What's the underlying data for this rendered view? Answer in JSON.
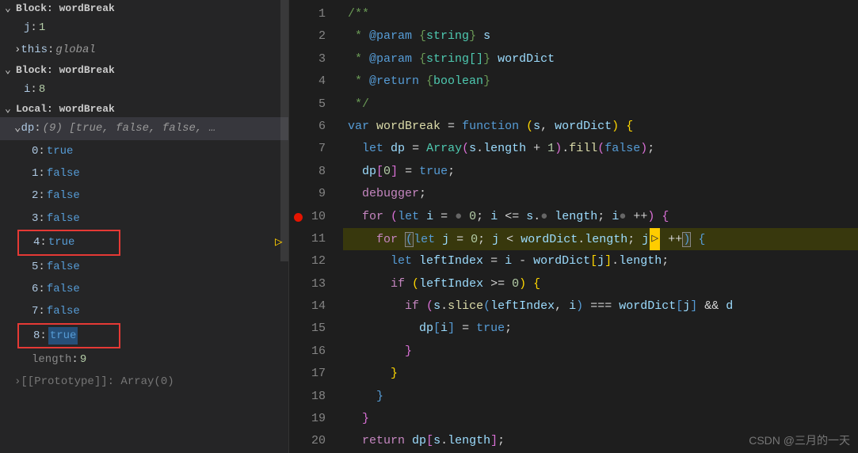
{
  "sidebar": {
    "scope1": {
      "label": "Block: wordBreak"
    },
    "j": {
      "key": "j",
      "val": "1"
    },
    "this": {
      "key": "this",
      "val": "global"
    },
    "scope2": {
      "label": "Block: wordBreak"
    },
    "i": {
      "key": "i",
      "val": "8"
    },
    "scope3": {
      "label": "Local: wordBreak"
    },
    "dp": {
      "key": "dp",
      "preview": "(9) [true, false, false, …"
    },
    "items": [
      {
        "key": "0",
        "val": "true"
      },
      {
        "key": "1",
        "val": "false"
      },
      {
        "key": "2",
        "val": "false"
      },
      {
        "key": "3",
        "val": "false"
      },
      {
        "key": "4",
        "val": "true"
      },
      {
        "key": "5",
        "val": "false"
      },
      {
        "key": "6",
        "val": "false"
      },
      {
        "key": "7",
        "val": "false"
      },
      {
        "key": "8",
        "val": "true"
      }
    ],
    "length": {
      "key": "length",
      "val": "9"
    },
    "proto": "[[Prototype]]: Array(0)"
  },
  "editor": {
    "lines": [
      "1",
      "2",
      "3",
      "4",
      "5",
      "6",
      "7",
      "8",
      "9",
      "10",
      "11",
      "12",
      "13",
      "14",
      "15",
      "16",
      "17",
      "18",
      "19",
      "20"
    ]
  },
  "code": {
    "l1": "/**",
    "l2p": " * ",
    "l2at": "@param",
    "l2brace": " {",
    "l2type": "string",
    "l2close": "} ",
    "l2var": "s",
    "l3at": "@param",
    "l3type": "string[]",
    "l3var": "wordDict",
    "l4at": "@return",
    "l4type": "boolean",
    "l5": " */",
    "var": "var",
    "wordBreak": "wordBreak",
    "eq": " = ",
    "function": "function",
    "s": "s",
    "wordDict": "wordDict",
    "let": "let",
    "dp": "dp",
    "Array": "Array",
    "length": "length",
    "plus1": " + ",
    "one": "1",
    "fill": "fill",
    "false": "false",
    "zero": "0",
    "true": "true",
    "debugger": "debugger",
    "for": "for",
    "i": "i",
    "lte": " <= ",
    "lt": " < ",
    "pp": " ++",
    "j": "j",
    "leftIndex": "leftIndex",
    "minus": " - ",
    "if": "if",
    "gte": " >= ",
    "slice": "slice",
    "eqeq": " === ",
    "and": " && ",
    "return": "return"
  },
  "watermark": "CSDN @三月的一天"
}
